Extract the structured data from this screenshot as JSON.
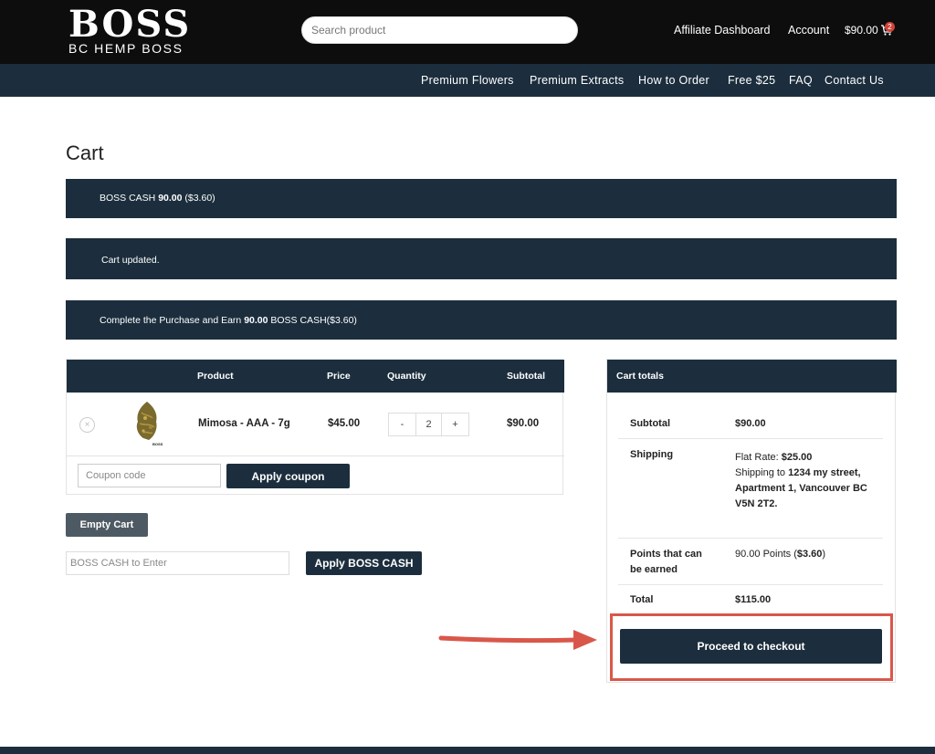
{
  "header": {
    "logo_main": "BOSS",
    "logo_sub": "BC HEMP BOSS",
    "search_placeholder": "Search product",
    "affiliate_label": "Affiliate Dashboard",
    "account_label": "Account",
    "cart_total": "$90.00",
    "cart_count": "2"
  },
  "nav": {
    "items": [
      "Premium Flowers",
      "Premium Extracts",
      "How to Order",
      "Free $25",
      "FAQ",
      "Contact Us"
    ]
  },
  "page": {
    "title": "Cart"
  },
  "notices": {
    "boss_cash_prefix": "BOSS CASH ",
    "boss_cash_amount": "90.00",
    "boss_cash_value": " ($3.60)",
    "cart_updated": "Cart updated.",
    "earn_prefix": "Complete the Purchase and Earn ",
    "earn_amount": "90.00",
    "earn_suffix": " BOSS CASH($3.60)"
  },
  "cart_table": {
    "headers": [
      "Product",
      "Price",
      "Quantity",
      "Subtotal"
    ],
    "rows": [
      {
        "remove": "×",
        "product": "Mimosa - AAA - 7g",
        "price": "$45.00",
        "qty_minus": "-",
        "qty": "2",
        "qty_plus": "+",
        "subtotal": "$90.00",
        "thumb_label": "BOSS"
      }
    ],
    "coupon_placeholder": "Coupon code",
    "apply_coupon_label": "Apply coupon"
  },
  "actions": {
    "empty_cart_label": "Empty Cart",
    "boss_cash_placeholder": "BOSS CASH to Enter",
    "apply_boss_cash_label": "Apply BOSS CASH"
  },
  "totals": {
    "heading": "Cart totals",
    "subtotal_label": "Subtotal",
    "subtotal_value": "$90.00",
    "shipping_label": "Shipping",
    "shipping_rate_prefix": "Flat Rate: ",
    "shipping_rate_value": "$25.00",
    "shipping_to_prefix": "Shipping to ",
    "shipping_address_line1": "1234 my street,",
    "shipping_address_line2": "Apartment 1, Vancouver BC",
    "shipping_address_line3": "V5N 2T2.",
    "points_label_line1": "Points that can",
    "points_label_line2": "be earned",
    "points_value_prefix": "90.00 Points (",
    "points_value_amount": "$3.60",
    "points_value_suffix": ")",
    "total_label": "Total",
    "total_value": "$115.00",
    "checkout_label": "Proceed to checkout"
  },
  "colors": {
    "header_bg": "#0d0d0d",
    "navy": "#1c2e3d",
    "highlight": "#d9574a",
    "badge": "#d0433a"
  }
}
